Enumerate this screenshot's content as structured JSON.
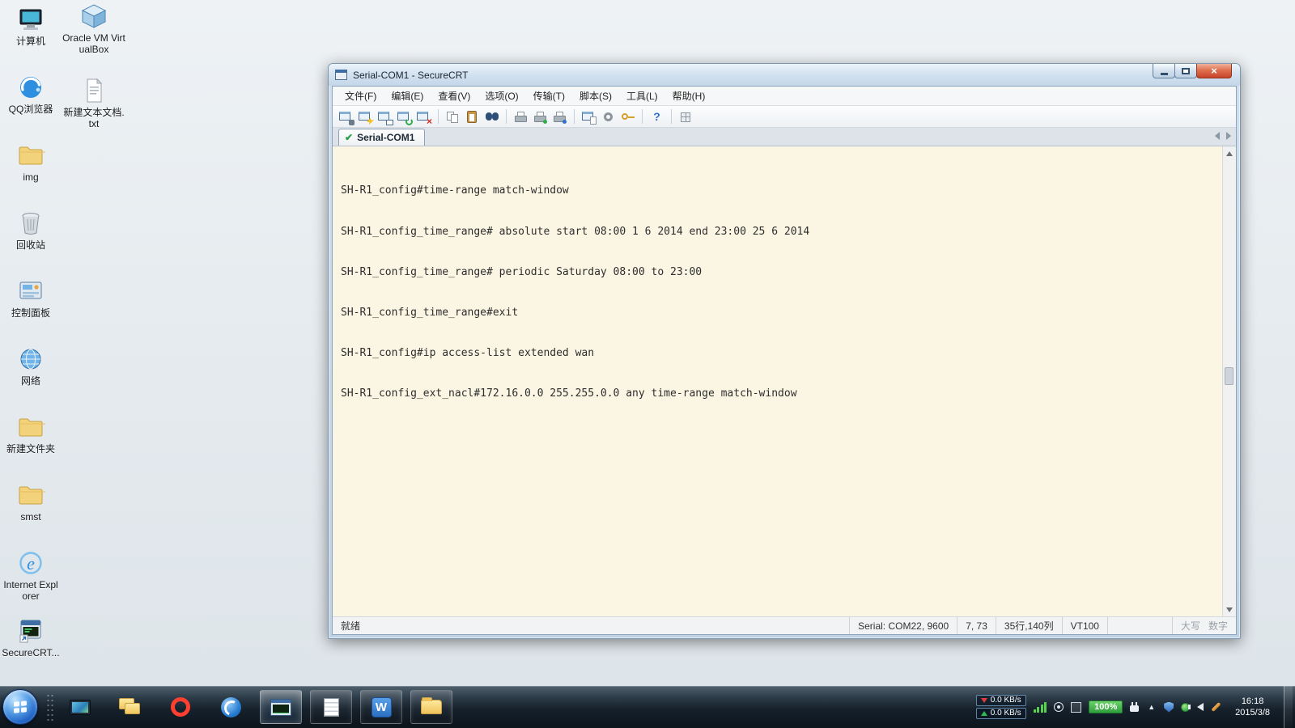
{
  "colors": {
    "terminal_background": "#fbf6e3",
    "close_button_red": "#c8432a",
    "battery_green": "#3fae4a",
    "down_arrow_red": "#e03c3c",
    "up_arrow_green": "#2fbe4f"
  },
  "desktop": {
    "col1": [
      {
        "icon": "computer-icon",
        "label": "计算机"
      },
      {
        "icon": "qq-browser-icon",
        "label": "QQ浏览器"
      },
      {
        "icon": "folder-icon",
        "label": "img"
      },
      {
        "icon": "recycle-bin-icon",
        "label": "回收站"
      },
      {
        "icon": "control-panel-icon",
        "label": "控制面板"
      },
      {
        "icon": "network-icon",
        "label": "网络"
      },
      {
        "icon": "folder-icon",
        "label": "新建文件夹"
      },
      {
        "icon": "folder-icon",
        "label": "smst"
      },
      {
        "icon": "internet-explorer-icon",
        "label": "Internet Explorer"
      },
      {
        "icon": "securecrt-icon",
        "label": "SecureCRT..."
      }
    ],
    "col2": [
      {
        "icon": "virtualbox-icon",
        "label": "Oracle VM VirtualBox"
      },
      {
        "icon": "text-document-icon",
        "label": "新建文本文档.txt"
      }
    ]
  },
  "window": {
    "title": "Serial-COM1 - SecureCRT",
    "close_glyph": "×",
    "menus": [
      "文件(F)",
      "编辑(E)",
      "查看(V)",
      "选项(O)",
      "传输(T)",
      "脚本(S)",
      "工具(L)",
      "帮助(H)"
    ],
    "toolbar_icons": [
      "connect",
      "quick-connect",
      "connect-in-tab",
      "reconnect",
      "disconnect",
      "copy",
      "paste",
      "find",
      "print",
      "print-setup",
      "print-preview",
      "properties",
      "global-options",
      "keymap",
      "help",
      "session-manager"
    ],
    "disconnect_glyph": "×",
    "help_glyph": "?",
    "tab_label": "Serial-COM1",
    "tab_check_glyph": "✔",
    "terminal": {
      "lines": [
        "SH-R1_config#time-range match-window",
        "SH-R1_config_time_range# absolute start 08:00 1 6 2014 end 23:00 25 6 2014",
        "SH-R1_config_time_range# periodic Saturday 08:00 to 23:00",
        "SH-R1_config_time_range#exit",
        "SH-R1_config#ip access-list extended wan",
        "SH-R1_config_ext_nacl#172.16.0.0 255.255.0.0 any time-range match-window"
      ]
    },
    "statusbar": {
      "ready": "就绪",
      "serial": "Serial: COM22, 9600",
      "cursor": "7, 73",
      "grid": "35行,140列",
      "emulation": "VT100",
      "caps": "大写",
      "num": "数字"
    }
  },
  "taskbar": {
    "apps": [
      "computer",
      "explorer-folders",
      "opera-browser",
      "blue-browser",
      "securecrt",
      "notepad",
      "w-app",
      "file-explorer"
    ],
    "w_badge": "W",
    "tray": {
      "hidden_arrow": "▲",
      "down_speed": "0.0 KB/s",
      "up_speed": "0.0 KB/s",
      "battery": "100%",
      "time": "16:18",
      "date": "2015/3/8"
    }
  }
}
